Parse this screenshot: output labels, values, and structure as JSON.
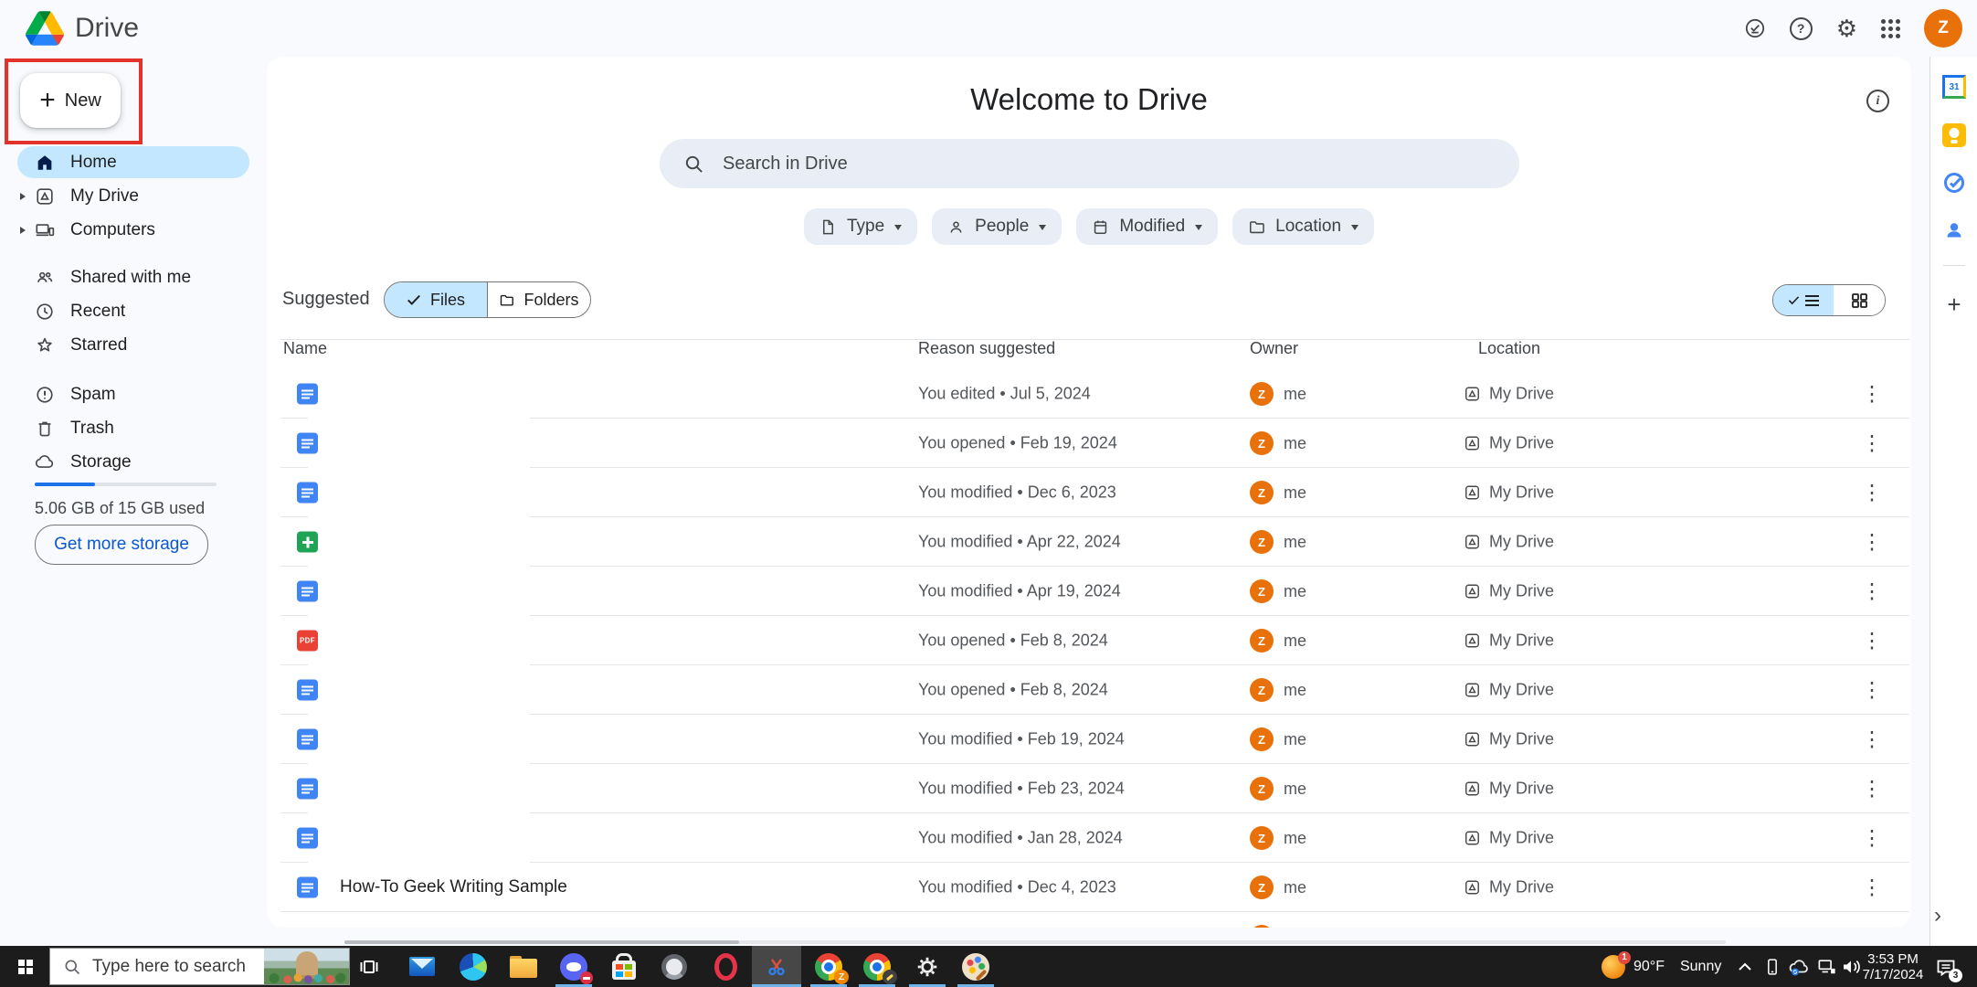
{
  "topbar": {
    "app_name": "Drive",
    "avatar_letter": "Z"
  },
  "new_button": {
    "plus": "+",
    "label": "New"
  },
  "sidebar": {
    "items": [
      {
        "label": "Home"
      },
      {
        "label": "My Drive"
      },
      {
        "label": "Computers"
      },
      {
        "label": "Shared with me"
      },
      {
        "label": "Recent"
      },
      {
        "label": "Starred"
      },
      {
        "label": "Spam"
      },
      {
        "label": "Trash"
      },
      {
        "label": "Storage"
      }
    ],
    "storage_percent": 33,
    "storage_text": "5.06 GB of 15 GB used",
    "storage_button": "Get more storage"
  },
  "main": {
    "title": "Welcome to Drive",
    "search_placeholder": "Search in Drive",
    "filters": [
      {
        "label": "Type"
      },
      {
        "label": "People"
      },
      {
        "label": "Modified"
      },
      {
        "label": "Location"
      }
    ],
    "suggested_label": "Suggested",
    "files_label": "Files",
    "folders_label": "Folders"
  },
  "table": {
    "headers": {
      "name": "Name",
      "reason": "Reason suggested",
      "owner": "Owner",
      "location": "Location"
    },
    "avatar_letter": "Z",
    "pdf_label": "PDF",
    "rows": [
      {
        "icon": "docs",
        "name": "",
        "reason": "You edited • Jul 5, 2024",
        "owner": "me",
        "location": "My Drive"
      },
      {
        "icon": "docs",
        "name": "",
        "reason": "You opened • Feb 19, 2024",
        "owner": "me",
        "location": "My Drive"
      },
      {
        "icon": "docs",
        "name": "",
        "reason": "You modified • Dec 6, 2023",
        "owner": "me",
        "location": "My Drive"
      },
      {
        "icon": "sheets",
        "name": "",
        "reason": "You modified • Apr 22, 2024",
        "owner": "me",
        "location": "My Drive"
      },
      {
        "icon": "docs",
        "name": "",
        "reason": "You modified • Apr 19, 2024",
        "owner": "me",
        "location": "My Drive"
      },
      {
        "icon": "pdf",
        "name": "",
        "reason": "You opened • Feb 8, 2024",
        "owner": "me",
        "location": "My Drive"
      },
      {
        "icon": "docs",
        "name": "",
        "reason": "You opened • Feb 8, 2024",
        "owner": "me",
        "location": "My Drive"
      },
      {
        "icon": "docs",
        "name": "",
        "reason": "You modified • Feb 19, 2024",
        "owner": "me",
        "location": "My Drive"
      },
      {
        "icon": "docs",
        "name": "",
        "reason": "You modified • Feb 23, 2024",
        "owner": "me",
        "location": "My Drive"
      },
      {
        "icon": "docs",
        "name": "",
        "reason": "You modified • Jan 28, 2024",
        "owner": "me",
        "location": "My Drive"
      },
      {
        "icon": "docs",
        "name": "How-To Geek Writing Sample",
        "reason": "You modified • Dec 4, 2023",
        "owner": "me",
        "location": "My Drive"
      }
    ]
  },
  "side_panel": {
    "calendar_label": "31",
    "plus": "+",
    "chevron": "›"
  },
  "taskbar": {
    "search_placeholder": "Type here to search",
    "chrome_profile_badge": "Z",
    "weather": {
      "temp": "90°F",
      "condition": "Sunny",
      "badge": "1"
    },
    "clock": {
      "time": "3:53 PM",
      "date": "7/17/2024"
    },
    "notification_badge": "3"
  },
  "icons": {
    "semantic": [
      "drive-logo",
      "offline-status-icon",
      "help-icon",
      "settings-gear-icon",
      "apps-grid-icon",
      "account-avatar",
      "plus-icon",
      "home-icon",
      "my-drive-icon",
      "computers-icon",
      "shared-icon",
      "recent-icon",
      "starred-icon",
      "spam-icon",
      "trash-icon",
      "storage-cloud-icon",
      "search-icon",
      "type-file-icon",
      "people-icon",
      "calendar-icon",
      "folder-icon",
      "check-icon",
      "list-view-icon",
      "grid-view-icon",
      "docs-file-icon",
      "sheets-file-icon",
      "pdf-file-icon",
      "more-options-icon",
      "info-icon",
      "keep-icon",
      "tasks-icon",
      "contacts-icon",
      "windows-start-icon",
      "task-view-icon"
    ]
  },
  "colors": {
    "accent_blue": "#0b57d0",
    "selection_blue": "#c2e7ff",
    "avatar_orange": "#e8710a",
    "annotation_red": "#e3322b",
    "taskbar_bg": "#1c1c1c",
    "page_bg": "#f8fafd"
  }
}
